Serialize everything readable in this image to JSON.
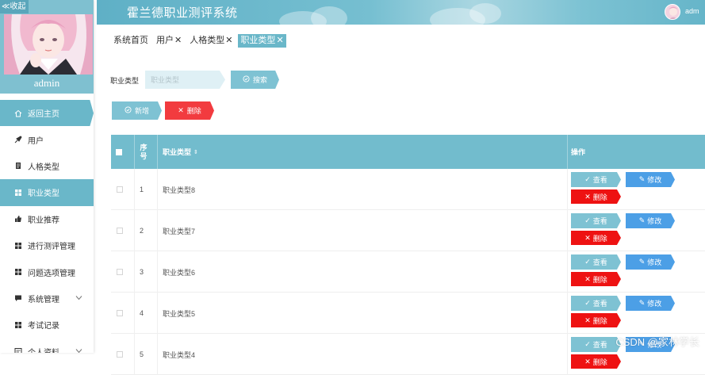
{
  "sidebar": {
    "collapse_label": "≪收起",
    "admin_name": "admin",
    "items": [
      {
        "label": "返回主页",
        "icon": "home-icon"
      },
      {
        "label": "用户",
        "icon": "pin-icon"
      },
      {
        "label": "人格类型",
        "icon": "document-icon"
      },
      {
        "label": "职业类型",
        "icon": "grid-icon"
      },
      {
        "label": "职业推荐",
        "icon": "thumbs-up-icon"
      },
      {
        "label": "进行测评管理",
        "icon": "grid-icon"
      },
      {
        "label": "问题选项管理",
        "icon": "grid-icon"
      },
      {
        "label": "系统管理",
        "icon": "message-icon"
      },
      {
        "label": "考试记录",
        "icon": "grid-icon"
      },
      {
        "label": "个人资料",
        "icon": "form-icon"
      }
    ]
  },
  "header": {
    "title": "霍兰德职业测评系统",
    "user_name": "adm"
  },
  "tabs": [
    {
      "label": "系统首页",
      "closable": false
    },
    {
      "label": "用户",
      "closable": true
    },
    {
      "label": "人格类型",
      "closable": true
    },
    {
      "label": "职业类型",
      "closable": true
    }
  ],
  "tab_close": "✕",
  "search": {
    "label": "职业类型",
    "placeholder": "职业类型",
    "button": "搜索"
  },
  "actions": {
    "add": "新增",
    "delete": "删除"
  },
  "table": {
    "headers": {
      "index": "序号",
      "type": "职业类型",
      "ops": "操作"
    },
    "rows": [
      {
        "index": "1",
        "type": "职业类型8"
      },
      {
        "index": "2",
        "type": "职业类型7"
      },
      {
        "index": "3",
        "type": "职业类型6"
      },
      {
        "index": "4",
        "type": "职业类型5"
      },
      {
        "index": "5",
        "type": "职业类型4"
      }
    ],
    "ops": {
      "view": "查看",
      "edit": "修改",
      "delete": "删除"
    }
  },
  "watermark": "CSDN @家林学长",
  "colors": {
    "primary": "#72bccd",
    "edit": "#4c9fe6",
    "danger": "#ee1212"
  }
}
